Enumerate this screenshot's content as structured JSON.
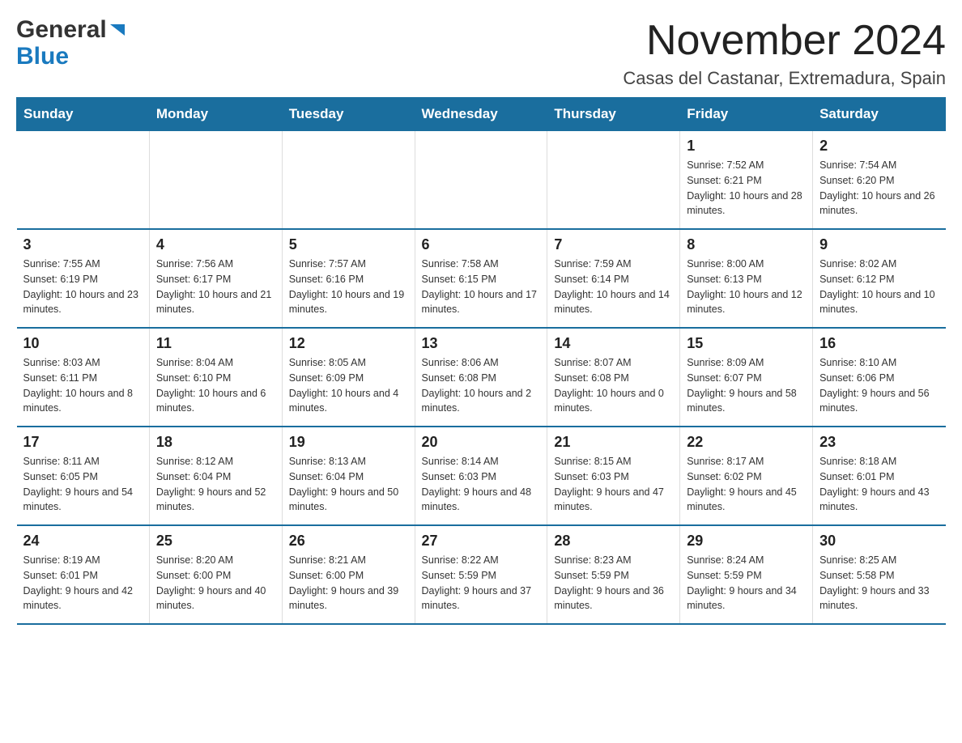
{
  "logo": {
    "general": "General",
    "blue": "Blue"
  },
  "title": "November 2024",
  "subtitle": "Casas del Castanar, Extremadura, Spain",
  "weekdays": [
    "Sunday",
    "Monday",
    "Tuesday",
    "Wednesday",
    "Thursday",
    "Friday",
    "Saturday"
  ],
  "weeks": [
    [
      {
        "day": "",
        "info": ""
      },
      {
        "day": "",
        "info": ""
      },
      {
        "day": "",
        "info": ""
      },
      {
        "day": "",
        "info": ""
      },
      {
        "day": "",
        "info": ""
      },
      {
        "day": "1",
        "info": "Sunrise: 7:52 AM\nSunset: 6:21 PM\nDaylight: 10 hours and 28 minutes."
      },
      {
        "day": "2",
        "info": "Sunrise: 7:54 AM\nSunset: 6:20 PM\nDaylight: 10 hours and 26 minutes."
      }
    ],
    [
      {
        "day": "3",
        "info": "Sunrise: 7:55 AM\nSunset: 6:19 PM\nDaylight: 10 hours and 23 minutes."
      },
      {
        "day": "4",
        "info": "Sunrise: 7:56 AM\nSunset: 6:17 PM\nDaylight: 10 hours and 21 minutes."
      },
      {
        "day": "5",
        "info": "Sunrise: 7:57 AM\nSunset: 6:16 PM\nDaylight: 10 hours and 19 minutes."
      },
      {
        "day": "6",
        "info": "Sunrise: 7:58 AM\nSunset: 6:15 PM\nDaylight: 10 hours and 17 minutes."
      },
      {
        "day": "7",
        "info": "Sunrise: 7:59 AM\nSunset: 6:14 PM\nDaylight: 10 hours and 14 minutes."
      },
      {
        "day": "8",
        "info": "Sunrise: 8:00 AM\nSunset: 6:13 PM\nDaylight: 10 hours and 12 minutes."
      },
      {
        "day": "9",
        "info": "Sunrise: 8:02 AM\nSunset: 6:12 PM\nDaylight: 10 hours and 10 minutes."
      }
    ],
    [
      {
        "day": "10",
        "info": "Sunrise: 8:03 AM\nSunset: 6:11 PM\nDaylight: 10 hours and 8 minutes."
      },
      {
        "day": "11",
        "info": "Sunrise: 8:04 AM\nSunset: 6:10 PM\nDaylight: 10 hours and 6 minutes."
      },
      {
        "day": "12",
        "info": "Sunrise: 8:05 AM\nSunset: 6:09 PM\nDaylight: 10 hours and 4 minutes."
      },
      {
        "day": "13",
        "info": "Sunrise: 8:06 AM\nSunset: 6:08 PM\nDaylight: 10 hours and 2 minutes."
      },
      {
        "day": "14",
        "info": "Sunrise: 8:07 AM\nSunset: 6:08 PM\nDaylight: 10 hours and 0 minutes."
      },
      {
        "day": "15",
        "info": "Sunrise: 8:09 AM\nSunset: 6:07 PM\nDaylight: 9 hours and 58 minutes."
      },
      {
        "day": "16",
        "info": "Sunrise: 8:10 AM\nSunset: 6:06 PM\nDaylight: 9 hours and 56 minutes."
      }
    ],
    [
      {
        "day": "17",
        "info": "Sunrise: 8:11 AM\nSunset: 6:05 PM\nDaylight: 9 hours and 54 minutes."
      },
      {
        "day": "18",
        "info": "Sunrise: 8:12 AM\nSunset: 6:04 PM\nDaylight: 9 hours and 52 minutes."
      },
      {
        "day": "19",
        "info": "Sunrise: 8:13 AM\nSunset: 6:04 PM\nDaylight: 9 hours and 50 minutes."
      },
      {
        "day": "20",
        "info": "Sunrise: 8:14 AM\nSunset: 6:03 PM\nDaylight: 9 hours and 48 minutes."
      },
      {
        "day": "21",
        "info": "Sunrise: 8:15 AM\nSunset: 6:03 PM\nDaylight: 9 hours and 47 minutes."
      },
      {
        "day": "22",
        "info": "Sunrise: 8:17 AM\nSunset: 6:02 PM\nDaylight: 9 hours and 45 minutes."
      },
      {
        "day": "23",
        "info": "Sunrise: 8:18 AM\nSunset: 6:01 PM\nDaylight: 9 hours and 43 minutes."
      }
    ],
    [
      {
        "day": "24",
        "info": "Sunrise: 8:19 AM\nSunset: 6:01 PM\nDaylight: 9 hours and 42 minutes."
      },
      {
        "day": "25",
        "info": "Sunrise: 8:20 AM\nSunset: 6:00 PM\nDaylight: 9 hours and 40 minutes."
      },
      {
        "day": "26",
        "info": "Sunrise: 8:21 AM\nSunset: 6:00 PM\nDaylight: 9 hours and 39 minutes."
      },
      {
        "day": "27",
        "info": "Sunrise: 8:22 AM\nSunset: 5:59 PM\nDaylight: 9 hours and 37 minutes."
      },
      {
        "day": "28",
        "info": "Sunrise: 8:23 AM\nSunset: 5:59 PM\nDaylight: 9 hours and 36 minutes."
      },
      {
        "day": "29",
        "info": "Sunrise: 8:24 AM\nSunset: 5:59 PM\nDaylight: 9 hours and 34 minutes."
      },
      {
        "day": "30",
        "info": "Sunrise: 8:25 AM\nSunset: 5:58 PM\nDaylight: 9 hours and 33 minutes."
      }
    ]
  ]
}
